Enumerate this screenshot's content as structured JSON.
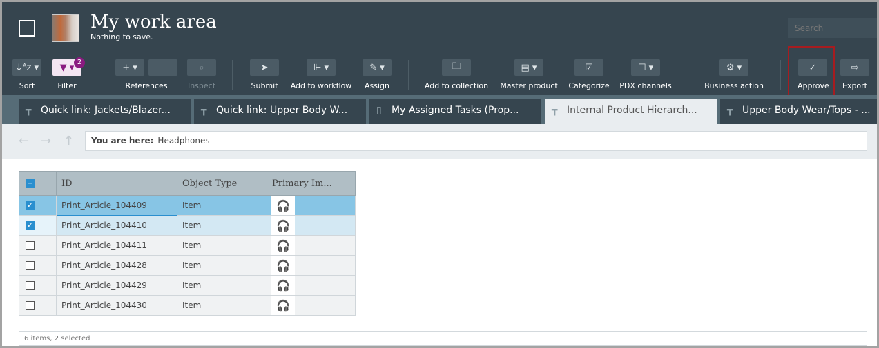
{
  "header": {
    "title": "My work area",
    "subtitle": "Nothing to save.",
    "search_placeholder": "Search"
  },
  "toolbar": [
    {
      "label": "Sort",
      "icon": "sort-icon"
    },
    {
      "label": "Filter",
      "icon": "filter-icon",
      "badge": "2"
    },
    {
      "label": "References",
      "icon": "plus-icon"
    },
    {
      "label": "Inspect",
      "icon": "inspect-icon"
    },
    {
      "label": "Submit",
      "icon": "send-icon"
    },
    {
      "label": "Add to workflow",
      "icon": "workflow-icon"
    },
    {
      "label": "Assign",
      "icon": "assign-icon"
    },
    {
      "label": "Add to collection",
      "icon": "collection-icon"
    },
    {
      "label": "Master product",
      "icon": "master-product-icon"
    },
    {
      "label": "Categorize",
      "icon": "categorize-icon"
    },
    {
      "label": "PDX channels",
      "icon": "pdx-icon"
    },
    {
      "label": "Business action",
      "icon": "gears-icon"
    },
    {
      "label": "Approve",
      "icon": "check-icon"
    },
    {
      "label": "Export",
      "icon": "export-icon"
    }
  ],
  "tabs": [
    {
      "label": "Quick link: Jackets/Blazer..."
    },
    {
      "label": "Quick link: Upper Body W..."
    },
    {
      "label": "My Assigned Tasks (Prop..."
    },
    {
      "label": "Internal Product Hierarch...",
      "active": true
    },
    {
      "label": "Upper Body Wear/Tops - ..."
    }
  ],
  "breadcrumb": {
    "label": "You are here:",
    "value": "Headphones"
  },
  "table": {
    "columns": [
      "ID",
      "Object Type",
      "Primary Im..."
    ],
    "rows": [
      {
        "id": "Print_Article_104409",
        "type": "Item",
        "checked": true
      },
      {
        "id": "Print_Article_104410",
        "type": "Item",
        "checked": true
      },
      {
        "id": "Print_Article_104411",
        "type": "Item",
        "checked": false
      },
      {
        "id": "Print_Article_104428",
        "type": "Item",
        "checked": false
      },
      {
        "id": "Print_Article_104429",
        "type": "Item",
        "checked": false
      },
      {
        "id": "Print_Article_104430",
        "type": "Item",
        "checked": false
      }
    ]
  },
  "status": "6 items, 2 selected",
  "colors": {
    "header_bg": "#36454f",
    "selected_row": "#87c5e5",
    "accent": "#2a8fcf",
    "approve_highlight": "#a61c20"
  }
}
